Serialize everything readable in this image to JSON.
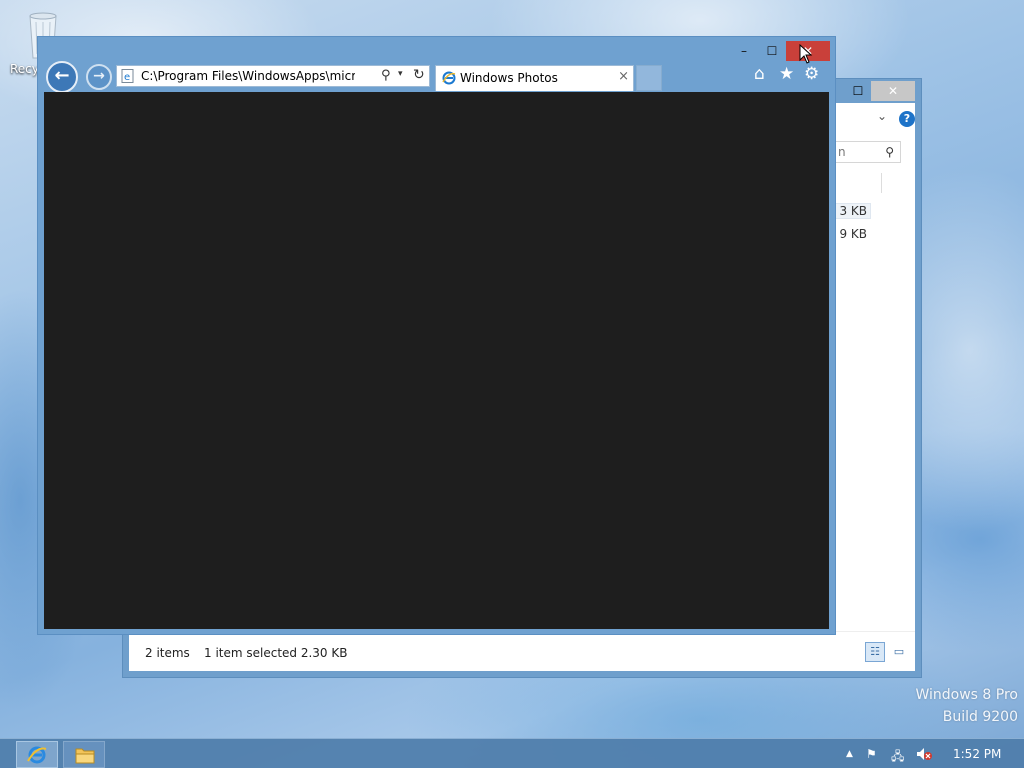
{
  "desktop": {
    "recycle_bin_label": "Recyc",
    "watermark_line1": "Windows 8 Pro",
    "watermark_line2": "Build 9200"
  },
  "explorer": {
    "search_placeholder": "n",
    "sizes": [
      "3 KB",
      "9 KB"
    ],
    "status_items": "2 items",
    "status_selected": "1 item selected  2.30 KB",
    "help_label": "?"
  },
  "ie": {
    "address_url": "C:\\Program Files\\WindowsApps\\microsoft.w",
    "tab_title": "Windows Photos",
    "tab_close": "×",
    "buttons": {
      "minimize": "–",
      "maximize": "☐",
      "close": "✕",
      "back": "←",
      "forward": "→",
      "home": "⌂",
      "favorites": "★",
      "tools": "⚙",
      "search": "⚲",
      "dropdown": "▾",
      "refresh": "↻"
    }
  },
  "taskbar": {
    "clock": "1:52 PM",
    "tray_up": "▲"
  },
  "colors": {
    "ie_frame": "#6fa1d0",
    "close_red": "#c9403a",
    "viewport_bg": "#1e1e1e"
  }
}
